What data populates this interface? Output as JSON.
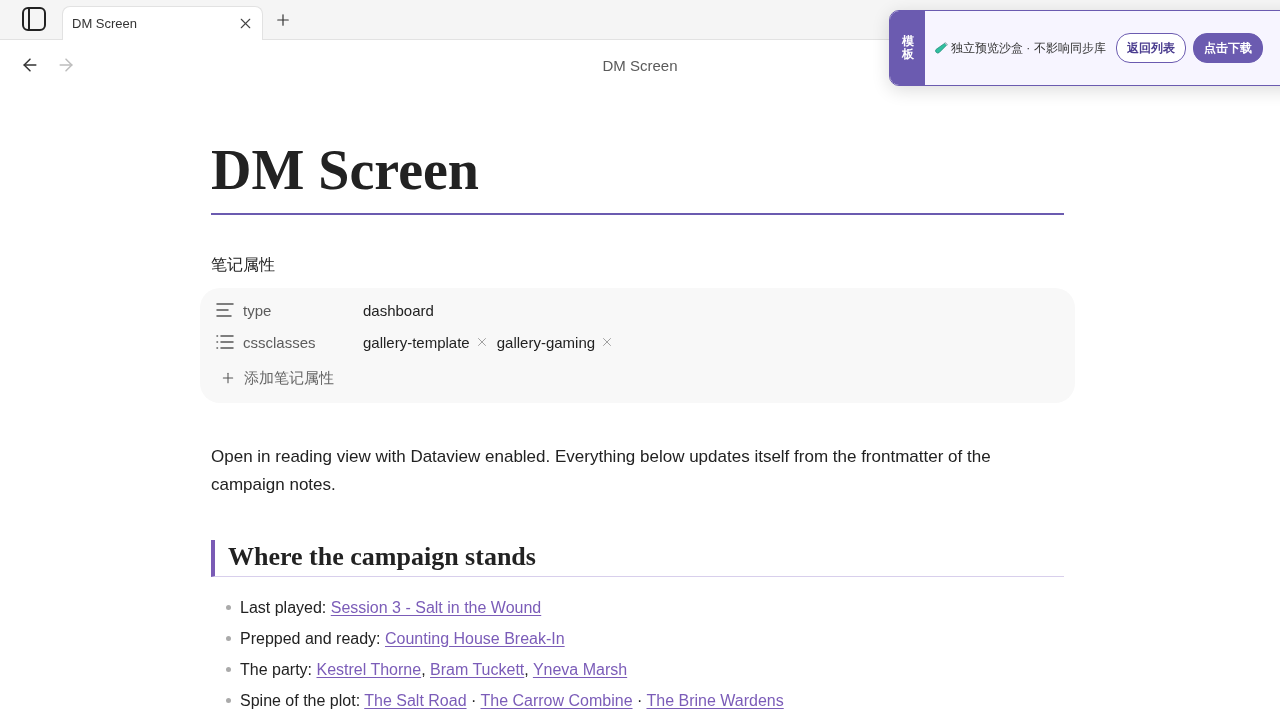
{
  "tab_bar": {
    "tabs": [
      {
        "title": "DM Screen",
        "selected": true
      }
    ]
  },
  "view_header": {
    "nav": [
      {
        "kind": "back",
        "disabled": false
      },
      {
        "kind": "forward",
        "disabled": true
      }
    ],
    "title": "DM Screen"
  },
  "banner": {
    "side_label": "模板",
    "message": "独立预览沙盒 · 不影响同步库",
    "buttons": [
      {
        "kind": "outline",
        "label": "返回列表"
      },
      {
        "kind": "filled",
        "label": "点击下载"
      }
    ]
  },
  "note": {
    "title": "DM Screen",
    "properties": {
      "heading": "笔记属性",
      "items": [
        {
          "kind": "text",
          "name": "type",
          "value": "dashboard"
        },
        {
          "kind": "list",
          "name": "cssclasses",
          "values": [
            "gallery-template",
            "gallery-gaming"
          ]
        }
      ],
      "add_label": "添加笔记属性"
    },
    "intro": "Open in reading view with Dataview enabled. Everything below updates itself from the frontmatter of the campaign notes.",
    "sections": [
      {
        "heading": "Where the campaign stands",
        "items": [
          {
            "label": "Last played:",
            "links": [
              "Session 3 - Salt in the Wound"
            ]
          },
          {
            "label": "Prepped and ready:",
            "links": [
              "Counting House Break-In"
            ]
          },
          {
            "label": "The party:",
            "links": [
              "Kestrel Thorne",
              "Bram Tuckett",
              "Yneva Marsh"
            ],
            "separator": ", "
          },
          {
            "label": "Spine of the plot:",
            "links": [
              "The Salt Road",
              "The Carrow Combine",
              "The Brine Wardens"
            ],
            "separator": " · "
          }
        ]
      }
    ]
  }
}
